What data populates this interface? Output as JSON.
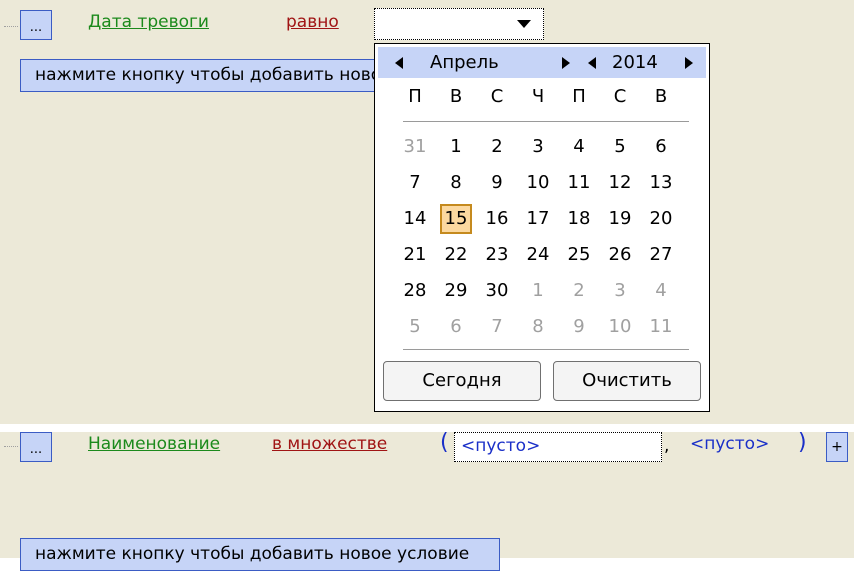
{
  "condition1": {
    "menu_button": "...",
    "field": "Дата тревоги",
    "operator": "равно",
    "value": ""
  },
  "add_condition_label": "нажмите кнопку чтобы добавить новое условие",
  "calendar": {
    "month": "Апрель",
    "year": "2014",
    "weekdays": [
      "П",
      "В",
      "С",
      "Ч",
      "П",
      "С",
      "В"
    ],
    "weeks": [
      [
        "31",
        "1",
        "2",
        "3",
        "4",
        "5",
        "6"
      ],
      [
        "7",
        "8",
        "9",
        "10",
        "11",
        "12",
        "13"
      ],
      [
        "14",
        "15",
        "16",
        "17",
        "18",
        "19",
        "20"
      ],
      [
        "21",
        "22",
        "23",
        "24",
        "25",
        "26",
        "27"
      ],
      [
        "28",
        "29",
        "30",
        "1",
        "2",
        "3",
        "4"
      ],
      [
        "5",
        "6",
        "7",
        "8",
        "9",
        "10",
        "11"
      ]
    ],
    "selected_day": "15",
    "today_button": "Сегодня",
    "clear_button": "Очистить"
  },
  "condition2": {
    "menu_button": "...",
    "field": "Наименование",
    "operator": "в множестве",
    "open_paren": "(",
    "value1": "<пусто>",
    "separator": ",",
    "value2": "<пусто>",
    "close_paren": ")",
    "add_button": "+"
  },
  "colors": {
    "panel_bg": "#ece9d8",
    "button_bg": "#c6d4f7",
    "field_link": "#1c8a1c",
    "operator_link": "#a01414",
    "value_text": "#1a2fc8",
    "today_highlight": "#fcd9a0"
  }
}
